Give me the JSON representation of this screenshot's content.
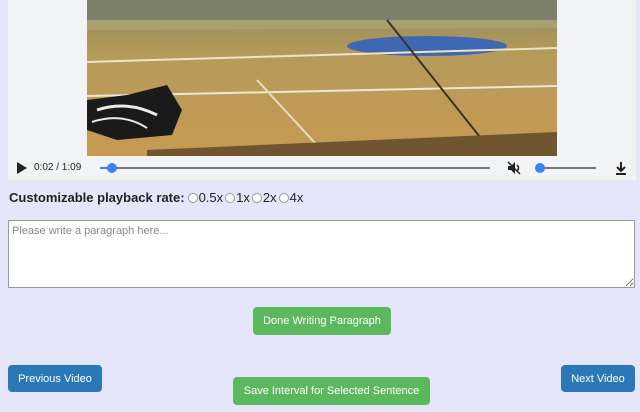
{
  "video": {
    "current_time": "0:02",
    "duration": "1:09",
    "time_display": "0:02 / 1:09",
    "progress": 0.03,
    "volume": 0.0,
    "muted": true
  },
  "playback": {
    "label": "Customizable playback rate:",
    "options": [
      "0.5x",
      "1x",
      "2x",
      "4x"
    ]
  },
  "paragraph": {
    "placeholder": "Please write a paragraph here...",
    "value": ""
  },
  "buttons": {
    "done": "Done Writing Paragraph",
    "previous": "Previous Video",
    "save": "Save Interval for Selected Sentence",
    "next": "Next Video"
  },
  "colors": {
    "background": "#e6e6fa",
    "green_button": "#5cb85c",
    "blue_button": "#2a78b8",
    "slider_accent": "#3b82f6"
  }
}
